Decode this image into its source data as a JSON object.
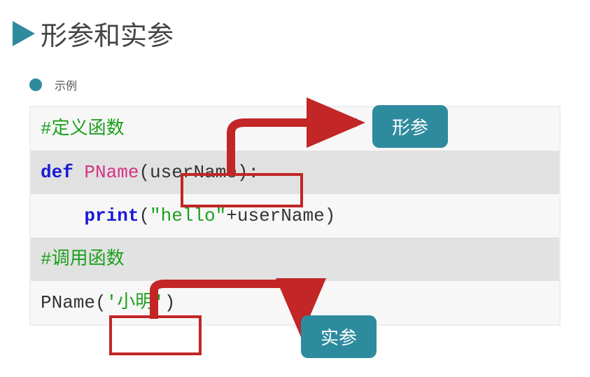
{
  "header": {
    "title": "形参和实参"
  },
  "subtitle": {
    "label": "示例"
  },
  "badges": {
    "formal": "形参",
    "actual": "实参"
  },
  "code": {
    "comment1": "#定义函数",
    "line2": {
      "def": "def ",
      "name": "PName",
      "args": "(userName)",
      "colon": ":"
    },
    "line3": {
      "indent": "    ",
      "print": "print",
      "open": "(",
      "str": "\"hello\"",
      "plus": "+userName)"
    },
    "comment2": "#调用函数",
    "line5": {
      "name": "PName",
      "open": "(",
      "arg": "'小明'",
      "close": ")"
    }
  }
}
